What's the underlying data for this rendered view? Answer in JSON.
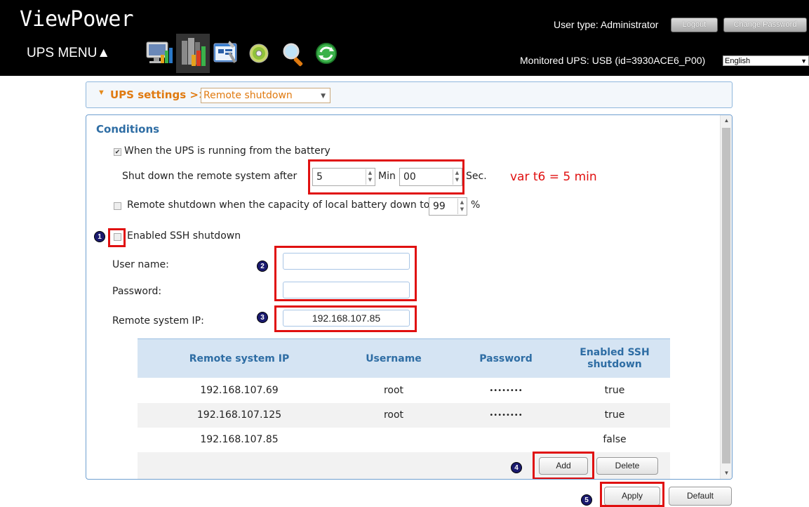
{
  "header": {
    "app_title": "ViewPower",
    "ups_menu": "UPS MENU▲",
    "user_type": "User type: Administrator",
    "logout_label": "Logout",
    "change_password_label": "Change Password",
    "monitored_ups": "Monitored UPS: USB (id=3930ACE6_P00)",
    "language": "English",
    "menu_icons": [
      "monitor-chart-icon",
      "books-chart-icon",
      "settings-tools-icon",
      "cd-icon",
      "search-icon",
      "refresh-icon"
    ]
  },
  "settings_bar": {
    "section": "UPS settings",
    "separator": ">>",
    "selected_page": "Remote shutdown"
  },
  "conditions": {
    "title": "Conditions",
    "on_battery_label": "When the UPS is running from the battery",
    "on_battery_checked": true,
    "shutdown_after_label": "Shut down the remote system after",
    "minutes_value": "5",
    "min_label": "Min",
    "seconds_value": "00",
    "sec_label": "Sec.",
    "annotation": "var t6 = 5 min",
    "capacity_label": "Remote shutdown when the capacity of local battery down to",
    "capacity_value": "99",
    "capacity_unit": "%",
    "capacity_checked": false,
    "ssh_label": "Enabled SSH shutdown",
    "ssh_checked": false,
    "username_label": "User name:",
    "username_value": "",
    "password_label": "Password:",
    "password_value": "",
    "remote_ip_label": "Remote system IP:",
    "remote_ip_value": "192.168.107.85"
  },
  "table": {
    "columns": [
      "Remote system IP",
      "Username",
      "Password",
      "Enabled SSH shutdown"
    ],
    "rows": [
      {
        "ip": "192.168.107.69",
        "username": "root",
        "password": "••••••••",
        "ssh": "true"
      },
      {
        "ip": "192.168.107.125",
        "username": "root",
        "password": "••••••••",
        "ssh": "true"
      },
      {
        "ip": "192.168.107.85",
        "username": "",
        "password": "",
        "ssh": "false"
      }
    ],
    "add_label": "Add",
    "delete_label": "Delete"
  },
  "footer": {
    "apply_label": "Apply",
    "default_label": "Default"
  },
  "badges": [
    "1",
    "2",
    "3",
    "4",
    "5"
  ],
  "colors": {
    "highlight_red": "#e01010",
    "accent_orange": "#e07a10",
    "heading_blue": "#2e6da4"
  }
}
